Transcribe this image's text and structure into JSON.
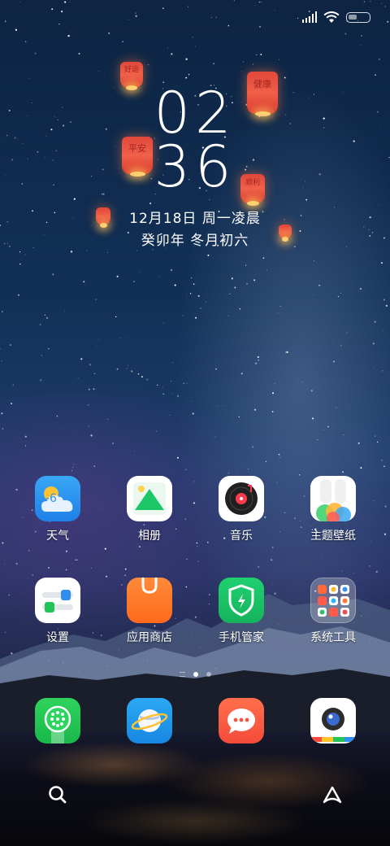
{
  "status_bar": {
    "signal": "signal-bars-icon",
    "wifi": "wifi-icon",
    "battery": "battery-icon"
  },
  "lockscreen": {
    "hours": "02",
    "minutes": "36",
    "date": "12月18日 周一凌晨",
    "lunar": "癸卯年 冬月初六"
  },
  "lanterns": {
    "l1": "好运",
    "l2": "健康",
    "l3": "平安",
    "l4": "顺利"
  },
  "apps_row1": [
    {
      "label": "天气",
      "icon": "weather-icon",
      "temp": "-6°"
    },
    {
      "label": "相册",
      "icon": "gallery-icon"
    },
    {
      "label": "音乐",
      "icon": "music-icon"
    },
    {
      "label": "主题壁纸",
      "icon": "themes-icon"
    }
  ],
  "apps_row2": [
    {
      "label": "设置",
      "icon": "settings-icon"
    },
    {
      "label": "应用商店",
      "icon": "app-store-icon"
    },
    {
      "label": "手机管家",
      "icon": "security-icon"
    },
    {
      "label": "系统工具",
      "icon": "folder-icon"
    }
  ],
  "dock": [
    {
      "icon": "phone-icon"
    },
    {
      "icon": "browser-icon"
    },
    {
      "icon": "messages-icon"
    },
    {
      "icon": "camera-icon"
    }
  ],
  "page_indicator": {
    "pages": 2,
    "current": 1
  },
  "bottom": {
    "left": "search-icon",
    "right": "app-drawer-icon"
  }
}
